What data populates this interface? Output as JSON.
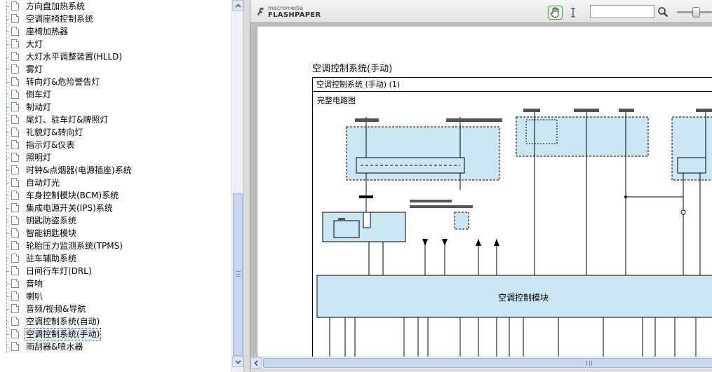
{
  "tree": {
    "items": [
      {
        "label": "方向盘加热系统",
        "selected": false
      },
      {
        "label": "空调座椅控制系统",
        "selected": false
      },
      {
        "label": "座椅加热器",
        "selected": false
      },
      {
        "label": "大灯",
        "selected": false
      },
      {
        "label": "大灯水平调整装置(HLLD)",
        "selected": false
      },
      {
        "label": "雾灯",
        "selected": false
      },
      {
        "label": "转向灯&危险警告灯",
        "selected": false
      },
      {
        "label": "倒车灯",
        "selected": false
      },
      {
        "label": "制动灯",
        "selected": false
      },
      {
        "label": "尾灯、驻车灯&牌照灯",
        "selected": false
      },
      {
        "label": "礼貌灯&转向灯",
        "selected": false
      },
      {
        "label": "指示灯&仪表",
        "selected": false
      },
      {
        "label": "照明灯",
        "selected": false
      },
      {
        "label": "时钟&点烟器(电源插座)系统",
        "selected": false
      },
      {
        "label": "自动灯光",
        "selected": false
      },
      {
        "label": "车身控制模块(BCM)系统",
        "selected": false
      },
      {
        "label": "集成电源开关(IPS)系统",
        "selected": false
      },
      {
        "label": "钥匙防盗系统",
        "selected": false
      },
      {
        "label": "智能钥匙模块",
        "selected": false
      },
      {
        "label": "轮胎压力监测系统(TPMS)",
        "selected": false
      },
      {
        "label": "驻车辅助系统",
        "selected": false
      },
      {
        "label": "日间行车灯(DRL)",
        "selected": false
      },
      {
        "label": "音响",
        "selected": false
      },
      {
        "label": "喇叭",
        "selected": false
      },
      {
        "label": "音频/视频&导航",
        "selected": false
      },
      {
        "label": "空调控制系统(自动)",
        "selected": false
      },
      {
        "label": "空调控制系统(手动)",
        "selected": true
      },
      {
        "label": "雨刮器&喷水器",
        "selected": false
      }
    ],
    "scroll_position": 0.52
  },
  "viewer": {
    "logo": {
      "sub": "macromedia",
      "main": "FLASHPAPER"
    },
    "find": {
      "value": "",
      "placeholder": ""
    },
    "zoom_level": 0.45,
    "icons": {
      "hand": "hand-tool-icon",
      "text": "text-select-icon",
      "find": "magnifier-icon",
      "scroll_up": "arrow-up-icon",
      "scroll_down": "arrow-down-icon",
      "scroll_left": "arrow-left-icon",
      "scroll_right": "arrow-right-icon"
    }
  },
  "document": {
    "section_title": "空调控制系统(手动)",
    "diagram_header": "空调控制系统 (手动) (1)",
    "diagram_subtitle": "完整电路图",
    "module_label": "空调控制模块"
  },
  "colors": {
    "selected_bg": "#e8eef7",
    "diagram_fill": "#c9e6f2",
    "hand_tool_border": "#3a9a3a",
    "scroll_thumb": "#c7d7f1"
  }
}
